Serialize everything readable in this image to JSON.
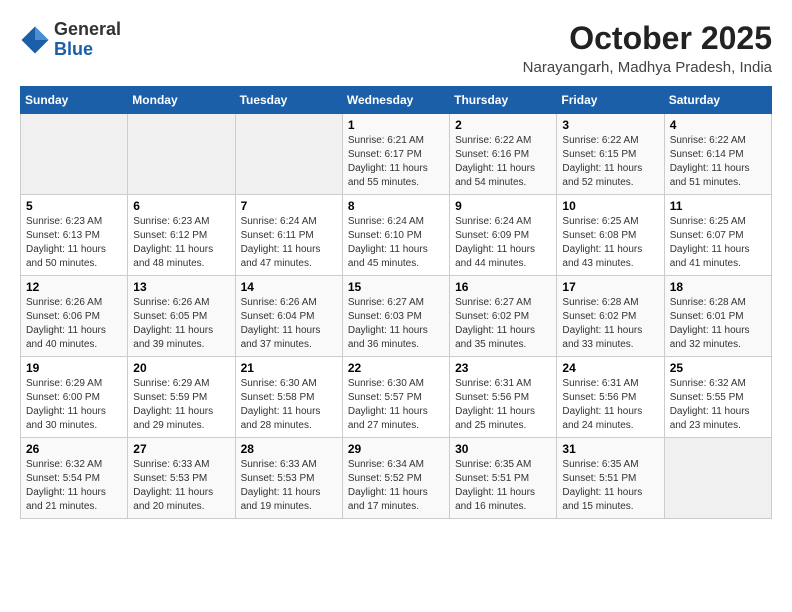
{
  "header": {
    "logo_general": "General",
    "logo_blue": "Blue",
    "month_year": "October 2025",
    "location": "Narayangarh, Madhya Pradesh, India"
  },
  "days_of_week": [
    "Sunday",
    "Monday",
    "Tuesday",
    "Wednesday",
    "Thursday",
    "Friday",
    "Saturday"
  ],
  "weeks": [
    [
      {
        "day": "",
        "info": ""
      },
      {
        "day": "",
        "info": ""
      },
      {
        "day": "",
        "info": ""
      },
      {
        "day": "1",
        "info": "Sunrise: 6:21 AM\nSunset: 6:17 PM\nDaylight: 11 hours and 55 minutes."
      },
      {
        "day": "2",
        "info": "Sunrise: 6:22 AM\nSunset: 6:16 PM\nDaylight: 11 hours and 54 minutes."
      },
      {
        "day": "3",
        "info": "Sunrise: 6:22 AM\nSunset: 6:15 PM\nDaylight: 11 hours and 52 minutes."
      },
      {
        "day": "4",
        "info": "Sunrise: 6:22 AM\nSunset: 6:14 PM\nDaylight: 11 hours and 51 minutes."
      }
    ],
    [
      {
        "day": "5",
        "info": "Sunrise: 6:23 AM\nSunset: 6:13 PM\nDaylight: 11 hours and 50 minutes."
      },
      {
        "day": "6",
        "info": "Sunrise: 6:23 AM\nSunset: 6:12 PM\nDaylight: 11 hours and 48 minutes."
      },
      {
        "day": "7",
        "info": "Sunrise: 6:24 AM\nSunset: 6:11 PM\nDaylight: 11 hours and 47 minutes."
      },
      {
        "day": "8",
        "info": "Sunrise: 6:24 AM\nSunset: 6:10 PM\nDaylight: 11 hours and 45 minutes."
      },
      {
        "day": "9",
        "info": "Sunrise: 6:24 AM\nSunset: 6:09 PM\nDaylight: 11 hours and 44 minutes."
      },
      {
        "day": "10",
        "info": "Sunrise: 6:25 AM\nSunset: 6:08 PM\nDaylight: 11 hours and 43 minutes."
      },
      {
        "day": "11",
        "info": "Sunrise: 6:25 AM\nSunset: 6:07 PM\nDaylight: 11 hours and 41 minutes."
      }
    ],
    [
      {
        "day": "12",
        "info": "Sunrise: 6:26 AM\nSunset: 6:06 PM\nDaylight: 11 hours and 40 minutes."
      },
      {
        "day": "13",
        "info": "Sunrise: 6:26 AM\nSunset: 6:05 PM\nDaylight: 11 hours and 39 minutes."
      },
      {
        "day": "14",
        "info": "Sunrise: 6:26 AM\nSunset: 6:04 PM\nDaylight: 11 hours and 37 minutes."
      },
      {
        "day": "15",
        "info": "Sunrise: 6:27 AM\nSunset: 6:03 PM\nDaylight: 11 hours and 36 minutes."
      },
      {
        "day": "16",
        "info": "Sunrise: 6:27 AM\nSunset: 6:02 PM\nDaylight: 11 hours and 35 minutes."
      },
      {
        "day": "17",
        "info": "Sunrise: 6:28 AM\nSunset: 6:02 PM\nDaylight: 11 hours and 33 minutes."
      },
      {
        "day": "18",
        "info": "Sunrise: 6:28 AM\nSunset: 6:01 PM\nDaylight: 11 hours and 32 minutes."
      }
    ],
    [
      {
        "day": "19",
        "info": "Sunrise: 6:29 AM\nSunset: 6:00 PM\nDaylight: 11 hours and 30 minutes."
      },
      {
        "day": "20",
        "info": "Sunrise: 6:29 AM\nSunset: 5:59 PM\nDaylight: 11 hours and 29 minutes."
      },
      {
        "day": "21",
        "info": "Sunrise: 6:30 AM\nSunset: 5:58 PM\nDaylight: 11 hours and 28 minutes."
      },
      {
        "day": "22",
        "info": "Sunrise: 6:30 AM\nSunset: 5:57 PM\nDaylight: 11 hours and 27 minutes."
      },
      {
        "day": "23",
        "info": "Sunrise: 6:31 AM\nSunset: 5:56 PM\nDaylight: 11 hours and 25 minutes."
      },
      {
        "day": "24",
        "info": "Sunrise: 6:31 AM\nSunset: 5:56 PM\nDaylight: 11 hours and 24 minutes."
      },
      {
        "day": "25",
        "info": "Sunrise: 6:32 AM\nSunset: 5:55 PM\nDaylight: 11 hours and 23 minutes."
      }
    ],
    [
      {
        "day": "26",
        "info": "Sunrise: 6:32 AM\nSunset: 5:54 PM\nDaylight: 11 hours and 21 minutes."
      },
      {
        "day": "27",
        "info": "Sunrise: 6:33 AM\nSunset: 5:53 PM\nDaylight: 11 hours and 20 minutes."
      },
      {
        "day": "28",
        "info": "Sunrise: 6:33 AM\nSunset: 5:53 PM\nDaylight: 11 hours and 19 minutes."
      },
      {
        "day": "29",
        "info": "Sunrise: 6:34 AM\nSunset: 5:52 PM\nDaylight: 11 hours and 17 minutes."
      },
      {
        "day": "30",
        "info": "Sunrise: 6:35 AM\nSunset: 5:51 PM\nDaylight: 11 hours and 16 minutes."
      },
      {
        "day": "31",
        "info": "Sunrise: 6:35 AM\nSunset: 5:51 PM\nDaylight: 11 hours and 15 minutes."
      },
      {
        "day": "",
        "info": ""
      }
    ]
  ]
}
